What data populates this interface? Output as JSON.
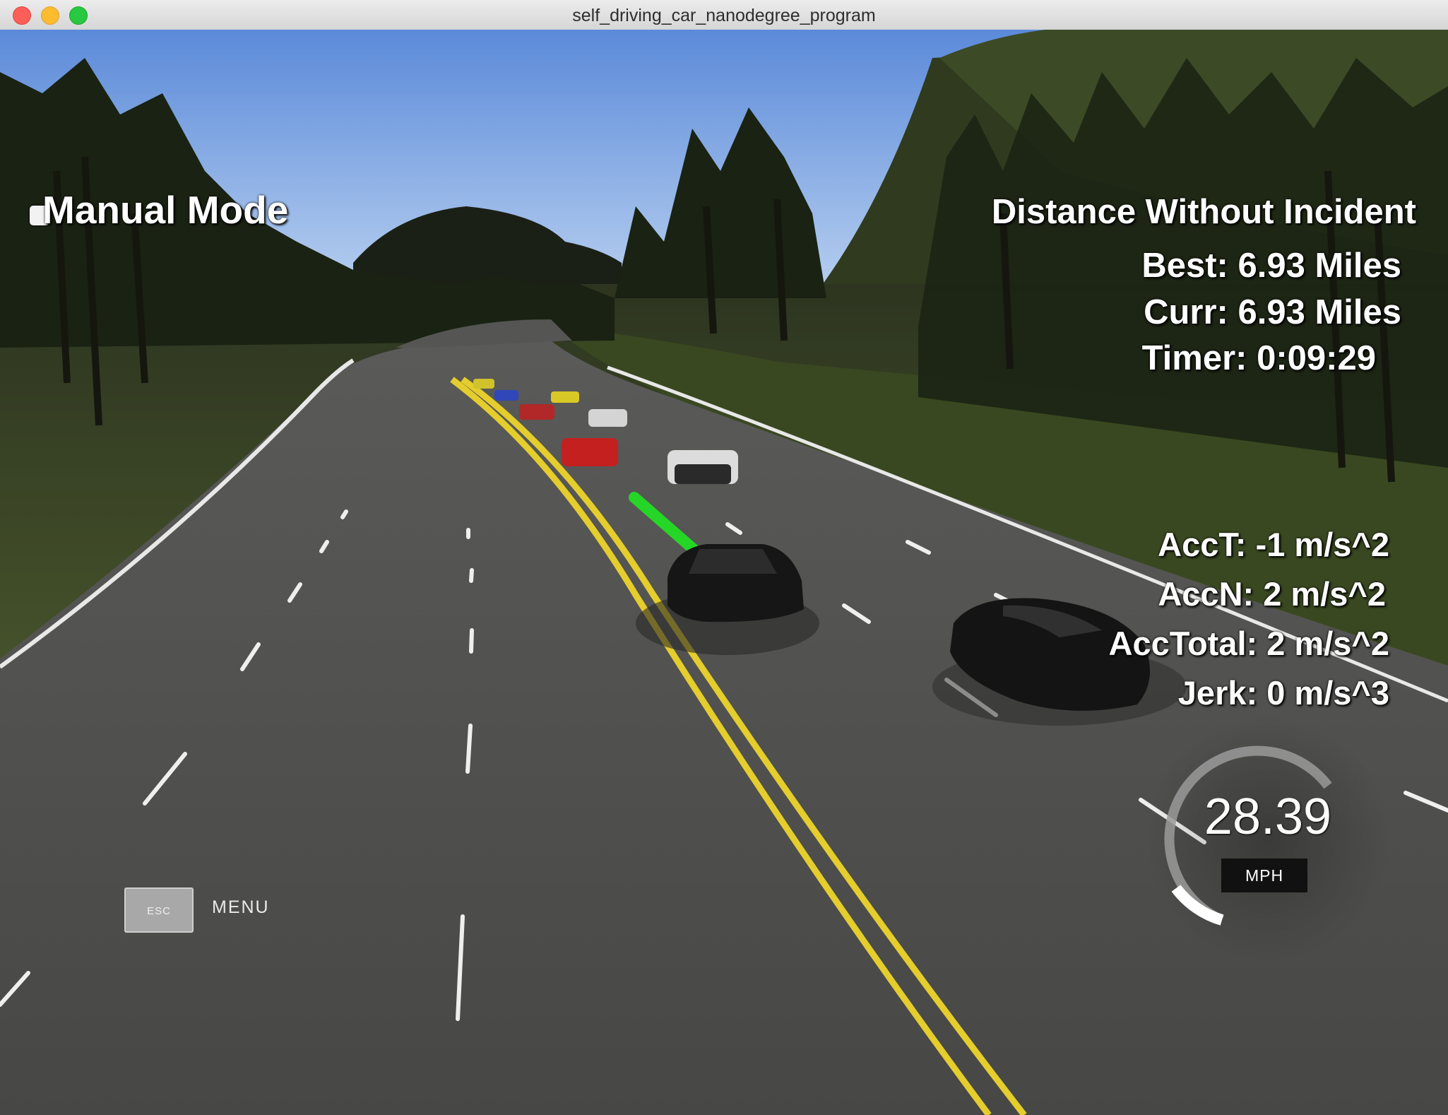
{
  "window": {
    "title": "self_driving_car_nanodegree_program"
  },
  "hud": {
    "mode_label": "Manual Mode",
    "distance_title": "Distance Without Incident",
    "best": "Best: 6.93 Miles",
    "curr": "Curr: 6.93 Miles",
    "timer": "Timer: 0:09:29",
    "acc_t": "AccT: -1 m/s^2",
    "acc_n": "AccN: 2 m/s^2",
    "acc_total": "AccTotal: 2 m/s^2",
    "jerk": "Jerk: 0 m/s^3"
  },
  "speedometer": {
    "value": "28.39",
    "unit": "MPH"
  },
  "menu": {
    "esc_label": "ESC",
    "menu_label": "MENU"
  },
  "colors": {
    "sky": "#6f9be0",
    "road": "#4b4b4a",
    "grass": "#3a4226",
    "center_line": "#e8d231",
    "path_line": "#2bd52b"
  }
}
